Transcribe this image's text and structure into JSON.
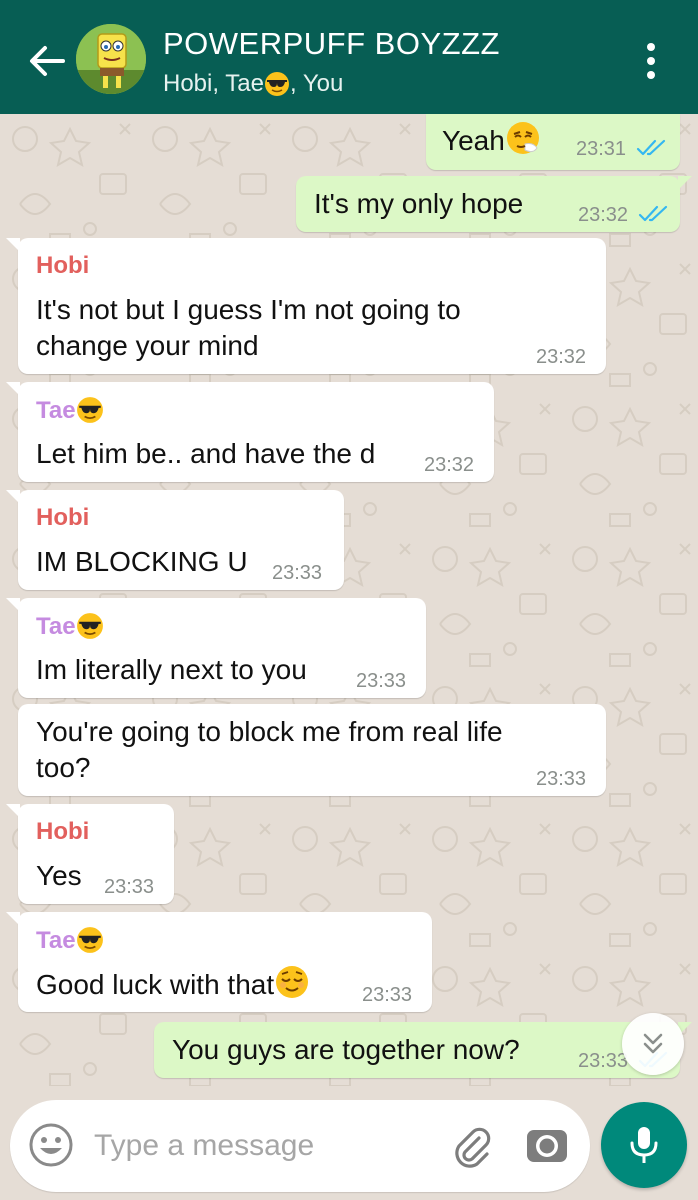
{
  "header": {
    "title": "POWERPUFF BOYZZZ",
    "subtitle_before": "Hobi, Tae",
    "subtitle_after": ", You"
  },
  "messages": [
    {
      "direction": "out",
      "text": "Yeah",
      "emoji": "sneezing-face",
      "time": "23:31",
      "status": "read"
    },
    {
      "direction": "out",
      "text": "It's my only hope",
      "time": "23:32",
      "status": "read"
    },
    {
      "direction": "in",
      "sender": "Hobi",
      "text_line1": "It's not but I guess I'm not going to",
      "text_line2": "change your mind",
      "time": "23:32"
    },
    {
      "direction": "in",
      "sender": "Tae",
      "sender_emoji": "sunglasses-face",
      "text": "Let him be.. and have the d",
      "time": "23:32"
    },
    {
      "direction": "in",
      "sender": "Hobi",
      "text": "IM BLOCKING U",
      "time": "23:33"
    },
    {
      "direction": "in",
      "sender": "Tae",
      "sender_emoji": "sunglasses-face",
      "text": "Im literally next to you",
      "time": "23:33"
    },
    {
      "direction": "in",
      "text_line1": "You're going to block me from real life",
      "text_line2": "too?",
      "time": "23:33"
    },
    {
      "direction": "in",
      "sender": "Hobi",
      "text": "Yes",
      "time": "23:33"
    },
    {
      "direction": "in",
      "sender": "Tae",
      "sender_emoji": "sunglasses-face",
      "text": "Good luck with that",
      "emoji": "relieved-face",
      "time": "23:33"
    },
    {
      "direction": "out",
      "text": "You guys are together now?",
      "time": "23:33",
      "status": "read"
    }
  ],
  "composer": {
    "placeholder": "Type a message"
  },
  "colors": {
    "header": "#075e54",
    "chat_background": "#e5ddd5",
    "outgoing_bubble": "#dcf8c6",
    "incoming_bubble": "#ffffff",
    "read_ticks": "#34b7f1",
    "hobi_name": "#e2605d",
    "tae_name": "#c58be0",
    "mic_button": "#00897b"
  },
  "icons": {
    "back": "arrow-left-icon",
    "menu": "more-vertical-icon",
    "scroll": "double-chevron-down-icon",
    "emoji": "smiley-icon",
    "attach": "paperclip-icon",
    "camera": "camera-icon",
    "mic": "microphone-icon"
  }
}
